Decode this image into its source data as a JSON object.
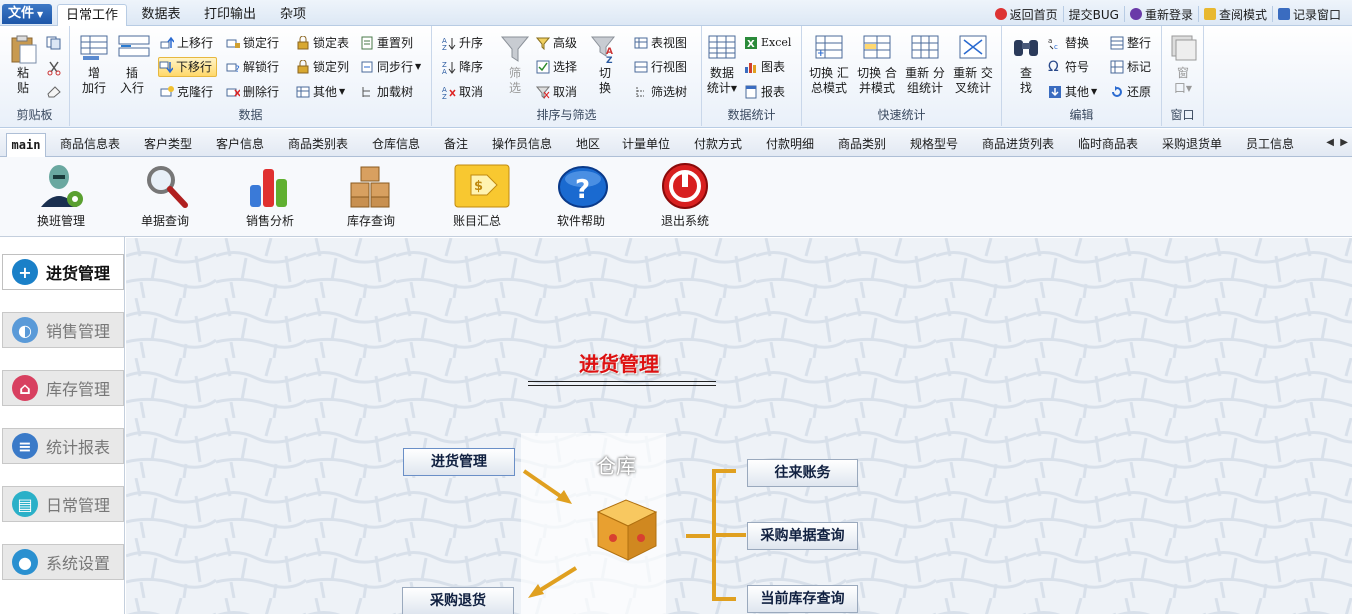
{
  "menubar": {
    "file_label": "文件",
    "tabs": [
      "日常工作",
      "数据表",
      "打印输出",
      "杂项"
    ],
    "right_items": [
      "返回首页",
      "提交BUG",
      "重新登录",
      "查阅模式",
      "记录窗口"
    ]
  },
  "ribbon": {
    "groups": {
      "clipboard": "剪贴板",
      "data": "数据",
      "sort_filter": "排序与筛选",
      "data_stats": "数据统计",
      "quick_stats": "快速统计",
      "edit": "编辑",
      "window": "窗口"
    },
    "clipboard": {
      "paste_line1": "粘",
      "paste_line2": "贴"
    },
    "data": {
      "add_line1": "增",
      "add_line2": "加行",
      "insert_line1": "插",
      "insert_line2": "入行",
      "move_up": "上移行",
      "move_down": "下移行",
      "clone_row": "克隆行",
      "lock_row": "锁定行",
      "unlock_row": "解锁行",
      "delete_row": "删除行",
      "lock_table": "锁定表",
      "lock_col": "锁定列",
      "other": "其他",
      "reset_col": "重置列",
      "sync_row": "同步行",
      "load_tree": "加载树"
    },
    "sort": {
      "asc": "升序",
      "desc": "降序",
      "cancel": "取消",
      "filter_line1": "筛",
      "filter_line2": "选",
      "advanced": "高级",
      "select": "选择",
      "cancel2": "取消",
      "switch_line1": "切",
      "switch_line2": "换"
    },
    "view": {
      "table_view": "表视图",
      "row_view": "行视图",
      "filter_tree": "筛选树"
    },
    "stats": {
      "data_stats_line1": "数据",
      "data_stats_line2": "统计",
      "excel": "Excel",
      "chart": "图表",
      "report": "报表"
    },
    "quick": {
      "q1_line1": "切换 汇",
      "q1_line2": "总模式",
      "q2_line1": "切换 合",
      "q2_line2": "并模式",
      "q3_line1": "重新 分",
      "q3_line2": "组统计",
      "q4_line1": "重新 交",
      "q4_line2": "叉统计"
    },
    "edit": {
      "find_line1": "查",
      "find_line2": "找",
      "replace": "替换",
      "symbol": "符号",
      "other": "其他",
      "tidy": "整行",
      "mark": "标记",
      "restore": "还原"
    },
    "window": {
      "win_line1": "窗",
      "win_line2": "口"
    }
  },
  "doc_tabs": [
    "main",
    "商品信息表",
    "客户类型",
    "客户信息",
    "商品类别表",
    "仓库信息",
    "备注",
    "操作员信息",
    "地区",
    "计量单位",
    "付款方式",
    "付款明细",
    "商品类别",
    "规格型号",
    "商品进货列表",
    "临时商品表",
    "采购退货单",
    "员工信息"
  ],
  "toolbar": [
    "换班管理",
    "单据查询",
    "销售分析",
    "库存查询",
    "账目汇总",
    "软件帮助",
    "退出系统"
  ],
  "sidebar": [
    "进货管理",
    "销售管理",
    "库存管理",
    "统计报表",
    "日常管理",
    "系统设置"
  ],
  "main": {
    "title": "进货管理",
    "warehouse": "仓库",
    "left_boxes": [
      "进货管理",
      "采购退货"
    ],
    "right_boxes": [
      "往来账务",
      "采购单据查询",
      "当前库存查询"
    ]
  },
  "colors": {
    "accent": "#1d56a8",
    "title_red": "#dd1111",
    "arrow_orange": "#e0a020"
  }
}
